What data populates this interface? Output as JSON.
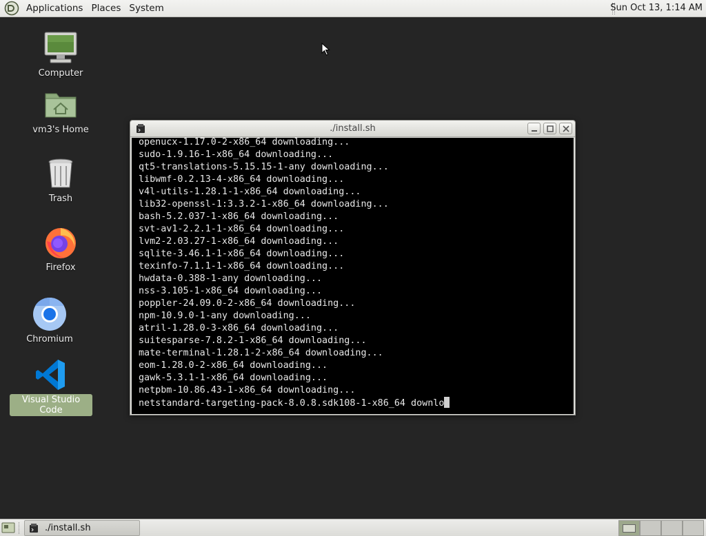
{
  "top_panel": {
    "menus": [
      "Applications",
      "Places",
      "System"
    ],
    "clock": "Sun Oct 13,  1:14 AM"
  },
  "desktop": {
    "icons": [
      {
        "label": "Computer",
        "icon": "computer-icon"
      },
      {
        "label": "vm3's Home",
        "icon": "home-folder-icon"
      },
      {
        "label": "Trash",
        "icon": "trash-icon"
      },
      {
        "label": "Firefox",
        "icon": "firefox-icon"
      },
      {
        "label": "Chromium",
        "icon": "chromium-icon"
      },
      {
        "label": "Visual Studio Code",
        "icon": "vscode-icon",
        "selected": true
      }
    ]
  },
  "terminal": {
    "title": "./install.sh",
    "lines": [
      "openucx-1.17.0-2-x86_64 downloading...",
      "sudo-1.9.16-1-x86_64 downloading...",
      "qt5-translations-5.15.15-1-any downloading...",
      "libwmf-0.2.13-4-x86_64 downloading...",
      "v4l-utils-1.28.1-1-x86_64 downloading...",
      "lib32-openssl-1:3.3.2-1-x86_64 downloading...",
      "bash-5.2.037-1-x86_64 downloading...",
      "svt-av1-2.2.1-1-x86_64 downloading...",
      "lvm2-2.03.27-1-x86_64 downloading...",
      "sqlite-3.46.1-1-x86_64 downloading...",
      "texinfo-7.1.1-1-x86_64 downloading...",
      "hwdata-0.388-1-any downloading...",
      "nss-3.105-1-x86_64 downloading...",
      "poppler-24.09.0-2-x86_64 downloading...",
      "npm-10.9.0-1-any downloading...",
      "atril-1.28.0-3-x86_64 downloading...",
      "suitesparse-7.8.2-1-x86_64 downloading...",
      "mate-terminal-1.28.1-2-x86_64 downloading...",
      "eom-1.28.0-2-x86_64 downloading...",
      "gawk-5.3.1-1-x86_64 downloading...",
      "netpbm-10.86.43-1-x86_64 downloading..."
    ],
    "current_line": "netstandard-targeting-pack-8.0.8.sdk108-1-x86_64 downlo"
  },
  "bottom_panel": {
    "taskbar": [
      {
        "label": "./install.sh"
      }
    ],
    "workspaces": 4,
    "active_workspace": 1
  },
  "colors": {
    "desktop_bg": "#252525",
    "selection_accent": "#9caf86",
    "terminal_bg": "#000000",
    "terminal_fg": "#e8e8e8"
  }
}
